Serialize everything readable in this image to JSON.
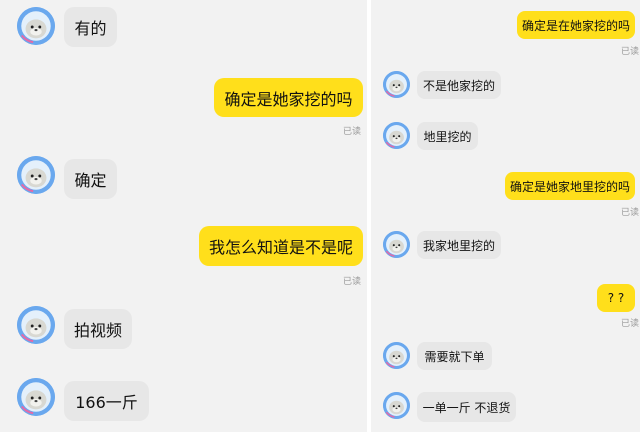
{
  "colors": {
    "my_bubble": "#ffdf1b",
    "their_bubble": "#e7e7e7",
    "background": "#f2f2f2",
    "avatar_ring": "#6aa8ee",
    "read_text": "#9a9a9a"
  },
  "left_panel": {
    "messages": [
      {
        "side": "them",
        "text": "有的"
      },
      {
        "side": "me",
        "text": "确定是她家挖的吗",
        "status": "已读"
      },
      {
        "side": "them",
        "text": "确定"
      },
      {
        "side": "me",
        "text": "我怎么知道是不是呢",
        "status": "已读"
      },
      {
        "side": "them",
        "text": "拍视频"
      },
      {
        "side": "them",
        "text": "166一斤"
      }
    ]
  },
  "right_panel": {
    "messages": [
      {
        "side": "me",
        "text": "确定是在她家挖的吗",
        "status": "已读"
      },
      {
        "side": "them",
        "text": "不是他家挖的"
      },
      {
        "side": "them",
        "text": "地里挖的"
      },
      {
        "side": "me",
        "text": "确定是她家地里挖的吗",
        "status": "已读"
      },
      {
        "side": "them",
        "text": "我家地里挖的"
      },
      {
        "side": "me",
        "text": "? ?",
        "status": "已读"
      },
      {
        "side": "them",
        "text": "需要就下单"
      },
      {
        "side": "them",
        "text": "一单一斤 不退货"
      }
    ]
  },
  "avatar_icon": "seal-astronaut-avatar-icon"
}
